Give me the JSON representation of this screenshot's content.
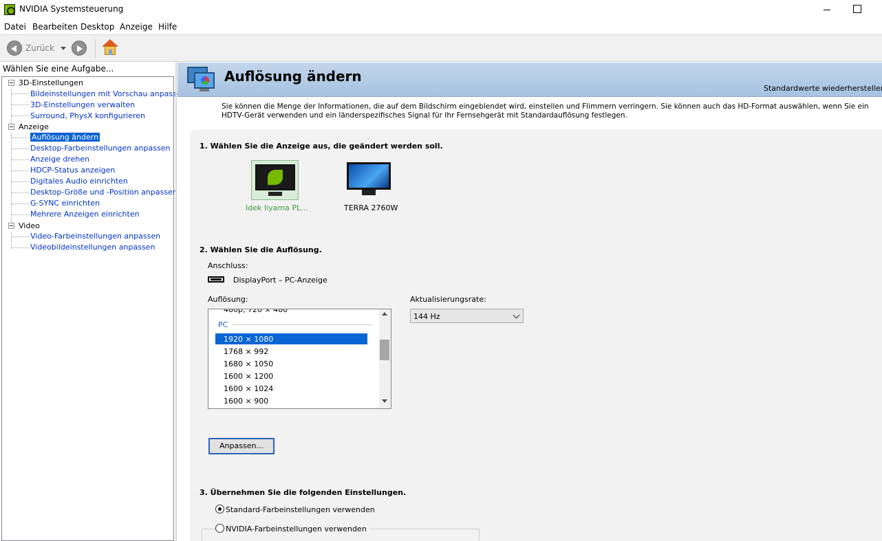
{
  "window": {
    "title": "NVIDIA Systemsteuerung"
  },
  "menu": {
    "items": [
      "Datei",
      "Bearbeiten",
      "Desktop",
      "Anzeige",
      "Hilfe"
    ]
  },
  "toolbar": {
    "back_label": "Zurück"
  },
  "sidebar": {
    "header": "Wählen Sie eine Aufgabe...",
    "categories": [
      {
        "label": "3D-Einstellungen",
        "items": [
          "Bildeinstellungen mit Vorschau anpassen",
          "3D-Einstellungen verwalten",
          "Surround, PhysX konfigurieren"
        ]
      },
      {
        "label": "Anzeige",
        "items": [
          "Auflösung ändern",
          "Desktop-Farbeinstellungen anpassen",
          "Anzeige drehen",
          "HDCP-Status anzeigen",
          "Digitales Audio einrichten",
          "Desktop-Größe und -Position anpassen",
          "G-SYNC einrichten",
          "Mehrere Anzeigen einrichten"
        ]
      },
      {
        "label": "Video",
        "items": [
          "Video-Farbeinstellungen anpassen",
          "Videobildeinstellungen anpassen"
        ]
      }
    ],
    "selected": "Auflösung ändern"
  },
  "page": {
    "title": "Auflösung ändern",
    "restore_link": "Standardwerte wiederherstellen",
    "description": "Sie können die Menge der Informationen, die auf dem Bildschirm eingeblendet wird, einstellen und Flimmern verringern. Sie können auch das HD-Format auswählen, wenn Sie ein HDTV-Gerät verwenden und ein länderspezifisches Signal für Ihr Fernsehgerät mit Standardauflösung festlegen."
  },
  "section1": {
    "title": "1. Wählen Sie die Anzeige aus, die geändert werden soll.",
    "displays": [
      "Idek Iiyama PL...",
      "TERRA 2760W"
    ],
    "selected_display": "Idek Iiyama PL..."
  },
  "section2": {
    "title": "2. Wählen Sie die Auflösung.",
    "connection_label": "Anschluss:",
    "connection_value": "DisplayPort – PC-Anzeige",
    "resolution_label": "Auflösung:",
    "resolution_partial": "480p, 720 × 480",
    "resolution_group": "PC",
    "resolutions": [
      "1920 × 1080",
      "1768 × 992",
      "1680 × 1050",
      "1600 × 1200",
      "1600 × 1024",
      "1600 × 900"
    ],
    "selected_resolution": "1920 × 1080",
    "refresh_label": "Aktualisierungsrate:",
    "refresh_value": "144 Hz",
    "customize_button": "Anpassen..."
  },
  "section3": {
    "title": "3. Übernehmen Sie die folgenden Einstellungen.",
    "options": [
      "Standard-Farbeinstellungen verwenden",
      "NVIDIA-Farbeinstellungen verwenden"
    ],
    "selected_option": "Standard-Farbeinstellungen verwenden"
  }
}
